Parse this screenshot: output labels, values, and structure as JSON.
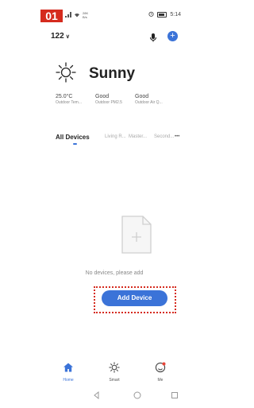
{
  "step_badge": "01",
  "status_bar": {
    "left_tiny_top": "28K",
    "left_tiny_bottom": "B/s",
    "time": "5:14"
  },
  "header": {
    "home_name": "122",
    "dropdown_glyph": "∨"
  },
  "weather": {
    "condition": "Sunny",
    "metrics": [
      {
        "value": "25.0°C",
        "label": "Outdoor Tem..."
      },
      {
        "value": "Good",
        "label": "Outdoor PM2.5"
      },
      {
        "value": "Good",
        "label": "Outdoor Air Q..."
      }
    ]
  },
  "tabs": [
    {
      "label": "All Devices",
      "active": true
    },
    {
      "label": "Living R...",
      "active": false
    },
    {
      "label": "Master...",
      "active": false
    },
    {
      "label": "Second...",
      "active": false
    }
  ],
  "more_glyph": "•••",
  "empty_state": {
    "message": "No devices, please add",
    "button_label": "Add Device"
  },
  "bottom_nav": [
    {
      "label": "Home",
      "icon": "home-icon",
      "active": true
    },
    {
      "label": "Smart",
      "icon": "sun-icon",
      "active": false
    },
    {
      "label": "Me",
      "icon": "profile-icon",
      "active": false
    }
  ],
  "colors": {
    "accent": "#3b73d8",
    "highlight": "#d52b1e",
    "notification": "#e8463a"
  }
}
